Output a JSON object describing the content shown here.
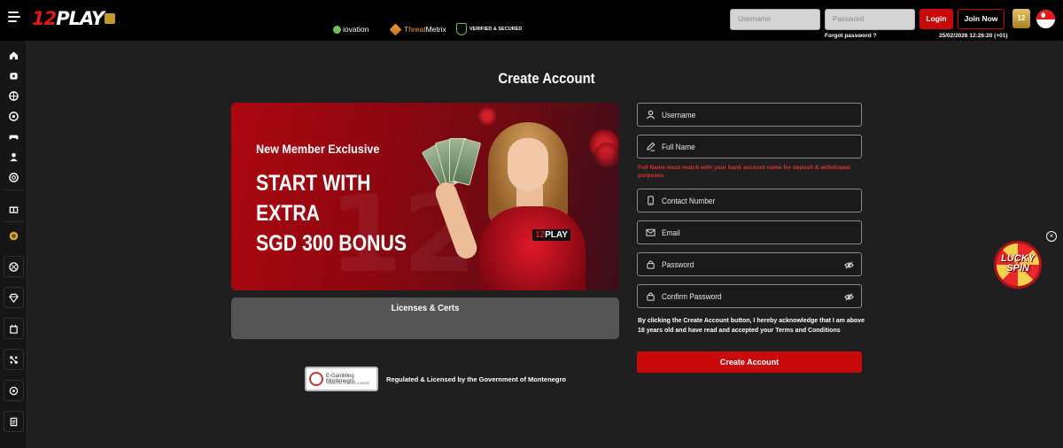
{
  "header": {
    "logo_num": "12",
    "logo_text": "PLAY",
    "username_placeholder": "Username",
    "password_placeholder": "Password",
    "forgot_password": "Forgot password ?",
    "login_label": "Login",
    "join_label": "Join Now",
    "datetime": "25/02/2026 12:26:20 (+01)",
    "badge_text": "12"
  },
  "sidebar": {
    "items": [
      "home-icon",
      "sports-icon",
      "casino-icon",
      "soccer-icon",
      "gamepad-icon",
      "poker-icon",
      "lottery-icon",
      "gift-icon",
      "coin-icon",
      "ball-icon",
      "diamond-icon",
      "vip-icon",
      "affiliate-icon",
      "location-icon",
      "info-icon"
    ]
  },
  "page": {
    "title": "Create Account"
  },
  "banner": {
    "kicker": "New Member Exclusive",
    "line1": "START WITH",
    "line2": "EXTRA",
    "line3": "SGD 300 BONUS",
    "tag_num": "12",
    "tag_text": "PLAY"
  },
  "licenses": {
    "title": "Licenses & Certs",
    "iovation": "iovation",
    "threat_a": "Threat",
    "threat_b": "Metrix",
    "verified_top": "VERIFIED & SECURED",
    "verified_sub": "SSL"
  },
  "regulated": {
    "seal_line1": "E-Gambling Montenegro",
    "seal_line2": "GAMBLING LICENSE & MORE",
    "text": "Regulated & Licensed by the Government of Montenegro"
  },
  "form": {
    "username": "Username",
    "full_name": "Full Name",
    "name_warning": "Full Name must match with your bank account name for deposit & withdrawal purposes",
    "contact": "Contact Number",
    "email": "Email",
    "password": "Password",
    "confirm_password": "Confirm Password",
    "terms_prefix": "By clicking the Create Account button, I hereby acknowledge that I am above 18 years old and have read and accepted your ",
    "terms_link": "Terms and Conditions",
    "submit": "Create Account"
  },
  "lucky_spin": {
    "line1": "LUCKY",
    "line2": "SPIN",
    "close": "×"
  },
  "colors": {
    "accent": "#c80a0a",
    "background": "#1f1f1f",
    "warning": "#e23030"
  }
}
